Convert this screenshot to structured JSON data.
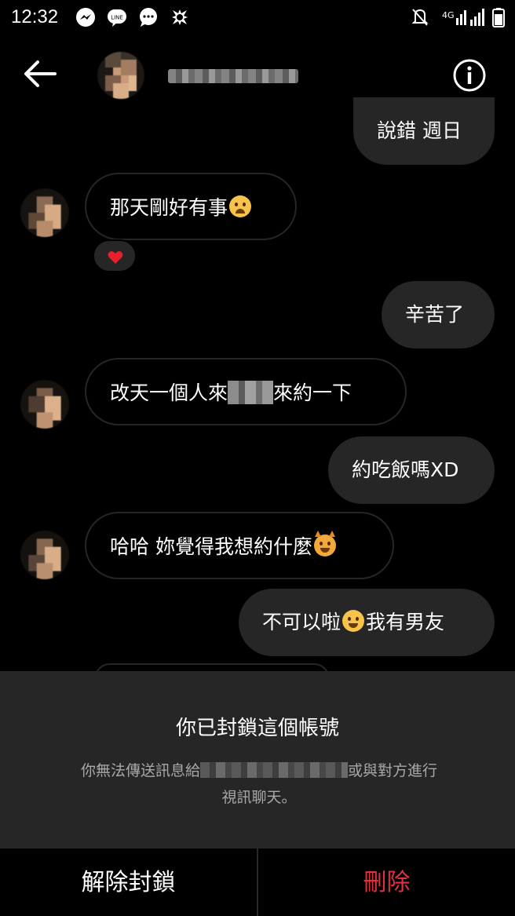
{
  "status_bar": {
    "time": "12:32",
    "left_icons": [
      "messenger-icon",
      "line-icon",
      "chat-bubble-icon",
      "nudge-icon"
    ],
    "right_icons": [
      "mute-icon",
      "4g-signal-icon",
      "signal-icon",
      "battery-icon"
    ]
  },
  "header": {
    "back_icon": "arrow-left-icon",
    "info_icon": "info-icon"
  },
  "messages": [
    {
      "side": "out",
      "text": "說錯 週日"
    },
    {
      "side": "in",
      "text": "那天剛好有事",
      "emoji": "weary-face",
      "reaction": "heart"
    },
    {
      "side": "out",
      "text": "辛苦了"
    },
    {
      "side": "in",
      "text_before": "改天一個人來",
      "text_after": "來約一下"
    },
    {
      "side": "out",
      "text": "約吃飯嗎XD"
    },
    {
      "side": "in",
      "text": "哈哈 妳覺得我想約什麼",
      "emoji": "smiling-devil"
    },
    {
      "side": "out",
      "text_before": "不可以啦",
      "emoji": "grinning-sweat",
      "text_after": "我有男友"
    }
  ],
  "blocked_panel": {
    "title": "你已封鎖這個帳號",
    "desc_before": "你無法傳送訊息給",
    "desc_after": "或與對方進行",
    "desc_line2": "視訊聊天。"
  },
  "actions": {
    "unblock_label": "解除封鎖",
    "delete_label": "刪除"
  },
  "colors": {
    "background": "#000000",
    "bubble_outgoing": "#262626",
    "panel": "#262626",
    "delete_red": "#e0313e",
    "reaction_heart": "#e8202a"
  }
}
